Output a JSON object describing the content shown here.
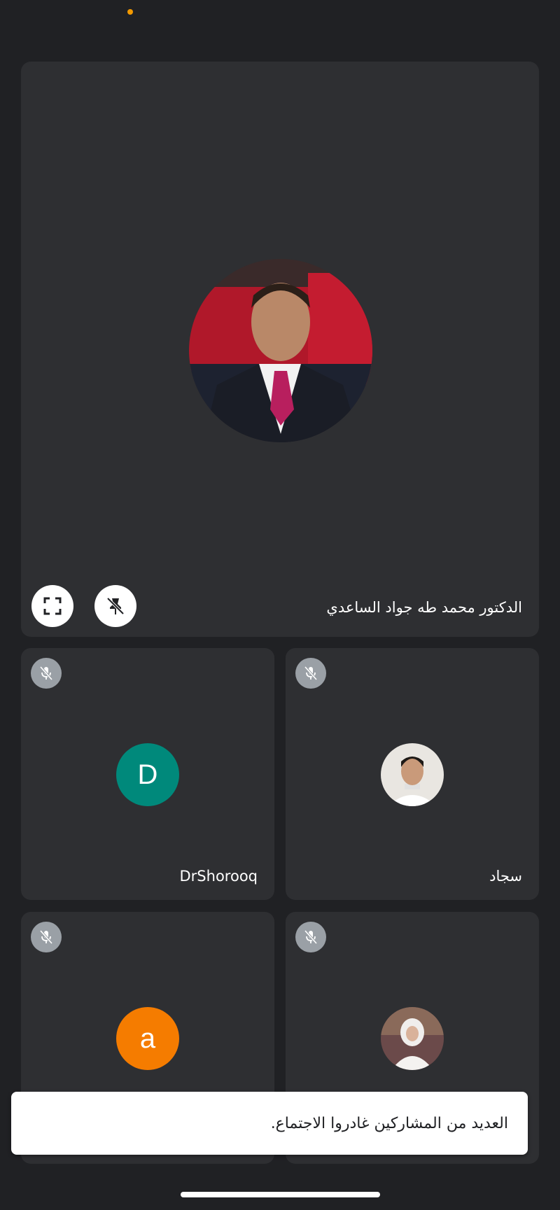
{
  "colors": {
    "background": "#202124",
    "tile": "#2e2f32",
    "teal_avatar": "#00897b",
    "orange_avatar": "#f57c00",
    "status_dot": "#f29900"
  },
  "main_speaker": {
    "name": "الدكتور محمد طه جواد الساعدي",
    "buttons": [
      "fullscreen-icon",
      "unpin-icon"
    ]
  },
  "participants": [
    {
      "name": "DrShorooq",
      "avatar_letter": "D",
      "muted": true
    },
    {
      "name": "سجاد",
      "avatar": "photo",
      "muted": true
    },
    {
      "name": "",
      "avatar_letter": "a",
      "muted": true
    },
    {
      "name": "",
      "avatar": "photo",
      "muted": true
    }
  ],
  "toast": {
    "message": "العديد من المشاركين غادروا الاجتماع."
  }
}
